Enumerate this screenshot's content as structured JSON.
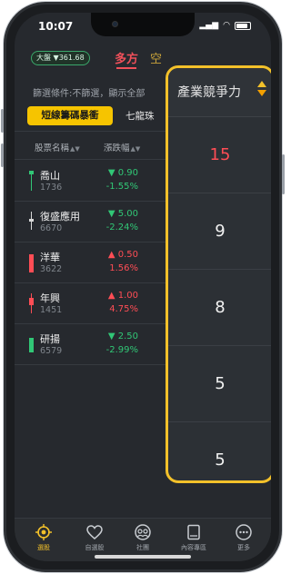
{
  "status": {
    "time": "10:07"
  },
  "header": {
    "market_chip": "大盤 ▼361.68",
    "tab_multi": "多方",
    "tab_empty": "空"
  },
  "filter_line": "篩選條件:不篩選，顯示全部",
  "strategies": {
    "active": "短線籌碼暴衝",
    "next": "七龍珠"
  },
  "table": {
    "col_name": "股票名稱",
    "col_change": "漲跌幅",
    "rows": [
      {
        "name": "喬山",
        "code": "1736",
        "price": "▼ 0.90",
        "pct": "-1.55%",
        "dir": "down"
      },
      {
        "name": "復盛應用",
        "code": "6670",
        "price": "▼ 5.00",
        "pct": "-2.24%",
        "dir": "down"
      },
      {
        "name": "洋華",
        "code": "3622",
        "price": "▲ 0.50",
        "pct": "1.56%",
        "dir": "up"
      },
      {
        "name": "年興",
        "code": "1451",
        "price": "▲ 1.00",
        "pct": "4.75%",
        "dir": "up"
      },
      {
        "name": "研揚",
        "code": "6579",
        "price": "▼ 2.50",
        "pct": "-2.99%",
        "dir": "down"
      }
    ]
  },
  "competitiveness": {
    "title": "產業競爭力",
    "values": [
      "15",
      "9",
      "8",
      "5",
      "5"
    ]
  },
  "nav": {
    "items": [
      {
        "label": "選股",
        "icon": "target-icon"
      },
      {
        "label": "自選股",
        "icon": "heart-icon"
      },
      {
        "label": "社團",
        "icon": "group-icon"
      },
      {
        "label": "內容專區",
        "icon": "book-icon"
      },
      {
        "label": "更多",
        "icon": "more-icon"
      }
    ]
  },
  "colors": {
    "accent": "#f3c12a",
    "up": "#ff4d55",
    "down": "#31c776",
    "tab_active": "#f0505a"
  }
}
